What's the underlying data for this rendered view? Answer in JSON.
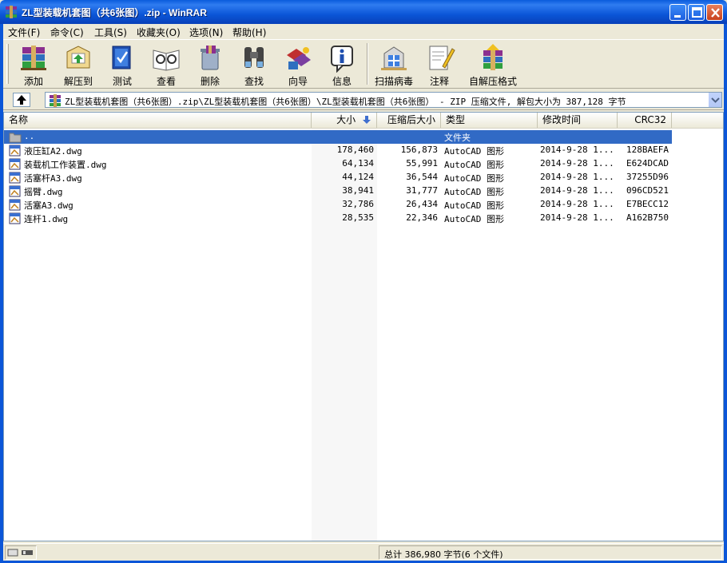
{
  "window": {
    "title": "ZL型装载机套图（共6张图）.zip - WinRAR"
  },
  "menu": [
    {
      "label": "文件(F)"
    },
    {
      "label": "命令(C)"
    },
    {
      "label": "工具(S)"
    },
    {
      "label": "收藏夹(O)"
    },
    {
      "label": "选项(N)"
    },
    {
      "label": "帮助(H)"
    }
  ],
  "toolbar": [
    {
      "label": "添加",
      "icon": "add-archive-icon"
    },
    {
      "label": "解压到",
      "icon": "extract-to-icon"
    },
    {
      "label": "测试",
      "icon": "test-icon"
    },
    {
      "label": "查看",
      "icon": "view-icon"
    },
    {
      "label": "删除",
      "icon": "delete-icon"
    },
    {
      "label": "查找",
      "icon": "find-icon"
    },
    {
      "label": "向导",
      "icon": "wizard-icon"
    },
    {
      "label": "信息",
      "icon": "info-icon"
    },
    {
      "label": "扫描病毒",
      "icon": "scan-virus-icon"
    },
    {
      "label": "注释",
      "icon": "comment-icon"
    },
    {
      "label": "自解压格式",
      "icon": "sfx-icon"
    }
  ],
  "address": {
    "path": "ZL型装载机套图（共6张图）.zip\\ZL型装载机套图（共6张图）\\ZL型装载机套图（共6张图） - ZIP 压缩文件, 解包大小为 387,128 字节"
  },
  "columns": {
    "name": "名称",
    "size": "大小",
    "packed": "压缩后大小",
    "type": "类型",
    "modified": "修改时间",
    "crc": "CRC32"
  },
  "parent_row": {
    "name": "..",
    "type": "文件夹"
  },
  "files": [
    {
      "name": "液压缸A2.dwg",
      "size": "178,460",
      "packed": "156,873",
      "type": "AutoCAD 图形",
      "modified": "2014-9-28 1...",
      "crc": "128BAEFA"
    },
    {
      "name": "装载机工作装置.dwg",
      "size": "64,134",
      "packed": "55,991",
      "type": "AutoCAD 图形",
      "modified": "2014-9-28 1...",
      "crc": "E624DCAD"
    },
    {
      "name": "活塞杆A3.dwg",
      "size": "44,124",
      "packed": "36,544",
      "type": "AutoCAD 图形",
      "modified": "2014-9-28 1...",
      "crc": "37255D96"
    },
    {
      "name": "摇臂.dwg",
      "size": "38,941",
      "packed": "31,777",
      "type": "AutoCAD 图形",
      "modified": "2014-9-28 1...",
      "crc": "096CD521"
    },
    {
      "name": "活塞A3.dwg",
      "size": "32,786",
      "packed": "26,434",
      "type": "AutoCAD 图形",
      "modified": "2014-9-28 1...",
      "crc": "E7BECC12"
    },
    {
      "name": "连杆1.dwg",
      "size": "28,535",
      "packed": "22,346",
      "type": "AutoCAD 图形",
      "modified": "2014-9-28 1...",
      "crc": "A162B750"
    }
  ],
  "status": {
    "summary": "总计 386,980 字节(6 个文件)"
  },
  "colors": {
    "titlebar": "#0b56d8",
    "selection": "#316ac5",
    "face": "#ece9d8"
  }
}
